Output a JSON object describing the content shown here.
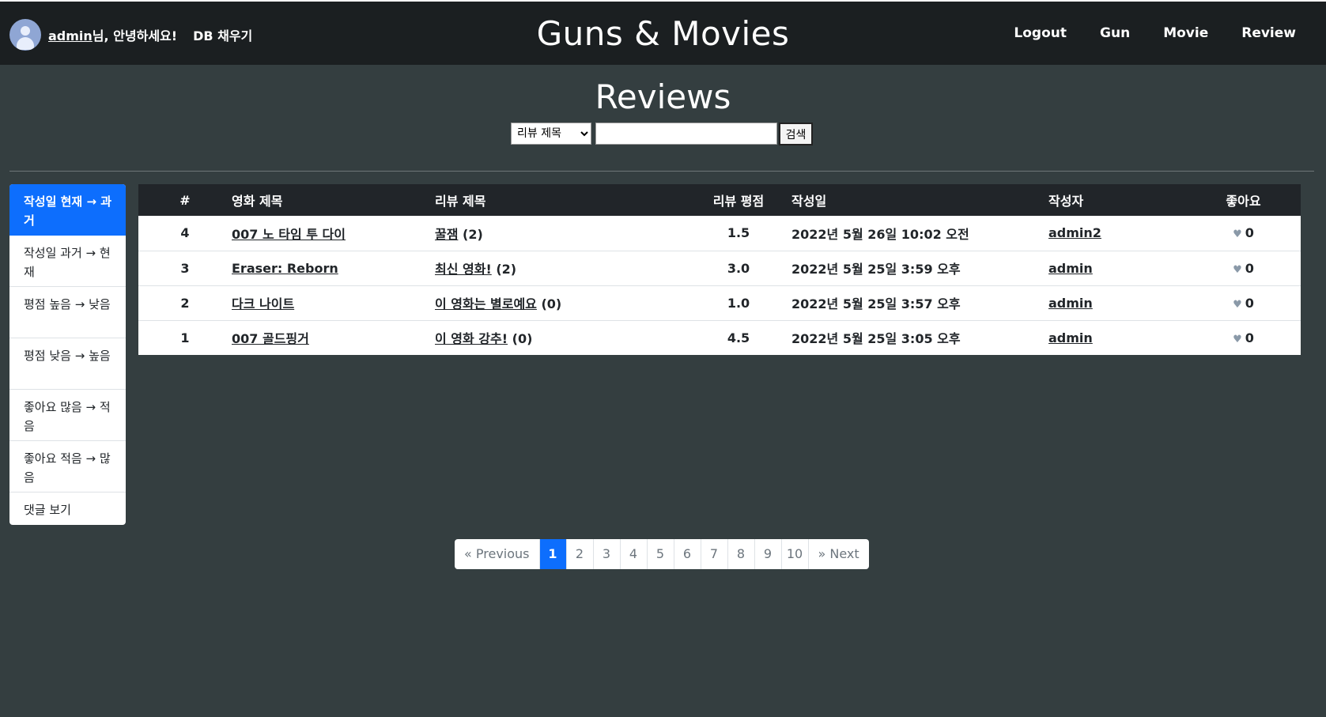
{
  "header": {
    "username": "admin",
    "greeting_suffix": "님, 안녕하세요!",
    "db_fill_label": "DB 채우기",
    "brand": "Guns & Movies",
    "nav": [
      "Logout",
      "Gun",
      "Movie",
      "Review"
    ]
  },
  "page": {
    "title": "Reviews",
    "search": {
      "selected_option": "리뷰 제목",
      "input_value": "",
      "button_label": "검색"
    }
  },
  "sidebar": {
    "items": [
      {
        "label": "작성일 현재 → 과거",
        "active": true
      },
      {
        "label": "작성일 과거 → 현재",
        "active": false
      },
      {
        "label": "평점 높음 → 낮음",
        "active": false
      },
      {
        "label": "평점 낮음 → 높음",
        "active": false
      },
      {
        "label": "좋아요 많음 → 적음",
        "active": false
      },
      {
        "label": "좋아요 적음 → 많음",
        "active": false
      },
      {
        "label": "댓글 보기",
        "active": false
      }
    ]
  },
  "table": {
    "headers": [
      "#",
      "영화 제목",
      "리뷰 제목",
      "리뷰 평점",
      "작성일",
      "작성자",
      "좋아요"
    ],
    "rows": [
      {
        "num": "4",
        "movie": "007 노 타임 투 다이",
        "review_title": "꿀잼",
        "comments": "(2)",
        "rating": "1.5",
        "date": "2022년 5월 26일 10:02 오전",
        "author": "admin2",
        "likes": "0"
      },
      {
        "num": "3",
        "movie": "Eraser: Reborn",
        "review_title": "최신 영화!",
        "comments": "(2)",
        "rating": "3.0",
        "date": "2022년 5월 25일 3:59 오후",
        "author": "admin",
        "likes": "0"
      },
      {
        "num": "2",
        "movie": "다크 나이트",
        "review_title": "이 영화는 별로예요",
        "comments": "(0)",
        "rating": "1.0",
        "date": "2022년 5월 25일 3:57 오후",
        "author": "admin",
        "likes": "0"
      },
      {
        "num": "1",
        "movie": "007 골드핑거",
        "review_title": "이 영화 강추!",
        "comments": "(0)",
        "rating": "4.5",
        "date": "2022년 5월 25일 3:05 오후",
        "author": "admin",
        "likes": "0"
      }
    ]
  },
  "pagination": {
    "previous": "« Previous",
    "pages": [
      "1",
      "2",
      "3",
      "4",
      "5",
      "6",
      "7",
      "8",
      "9",
      "10"
    ],
    "current": "1",
    "next": "» Next"
  },
  "colors": {
    "page_bg": "#343e40",
    "header_bg": "#1b1f21",
    "accent": "#0d6efd",
    "table_head": "#212529",
    "heart": "#8a99a8"
  },
  "icons": {
    "avatar": "user-avatar-icon",
    "like": "heart-icon"
  }
}
